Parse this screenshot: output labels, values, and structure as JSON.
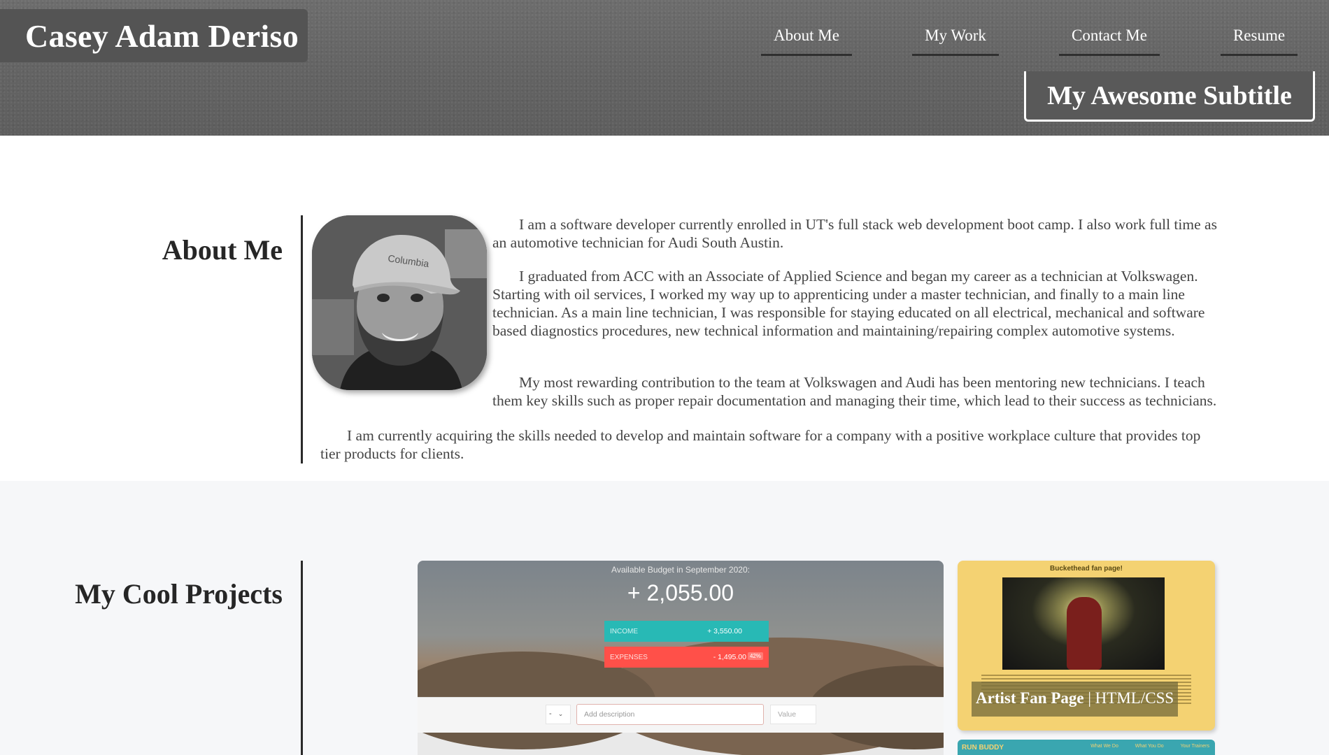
{
  "header": {
    "name": "Casey Adam Deriso",
    "subtitle": "My Awesome Subtitle",
    "nav": [
      {
        "label": "About Me"
      },
      {
        "label": "My Work"
      },
      {
        "label": "Contact Me"
      },
      {
        "label": "Resume"
      }
    ]
  },
  "about": {
    "title": "About Me",
    "paragraphs": [
      "I am a software developer currently enrolled in UT's full stack web development boot camp. I also work full time as an automotive technician for Audi South Austin.",
      "I graduated from ACC with an Associate of Applied Science and began my career as a technician at Volkswagen. Starting with oil services, I worked my way up to apprenticing under a master technician, and finally to a main line technician. As a main line technician, I was responsible for staying educated on all electrical, mechanical and software based diagnostics procedures, new technical information and maintaining/repairing complex automotive systems.",
      "My most rewarding contribution to the team at Volkswagen and Audi has been mentoring new technicians. I teach them key skills such as proper repair documentation and managing their time, which lead to their success as technicians.",
      "I am currently acquiring the skills needed to develop and maintain software for a company with a positive workplace culture that provides top tier products for clients."
    ]
  },
  "projects": {
    "title": "My Cool Projects",
    "budget_app": {
      "title": "Available Budget in September 2020:",
      "value": "+ 2,055.00",
      "income_label": "INCOME",
      "income_value": "+ 3,550.00",
      "expenses_label": "EXPENSES",
      "expenses_value": "- 1,495.00",
      "expenses_pct": "42%",
      "type_select": "-",
      "description_placeholder": "Add description",
      "value_placeholder": "Value"
    },
    "fan_page": {
      "heading": "Buckethead fan page!",
      "label_main": "Artist Fan Page",
      "label_tech": " | HTML/CSS"
    },
    "run_buddy": {
      "title": "RUN BUDDY",
      "links": [
        "What We Do",
        "What You Do",
        "Your Trainers"
      ]
    }
  }
}
